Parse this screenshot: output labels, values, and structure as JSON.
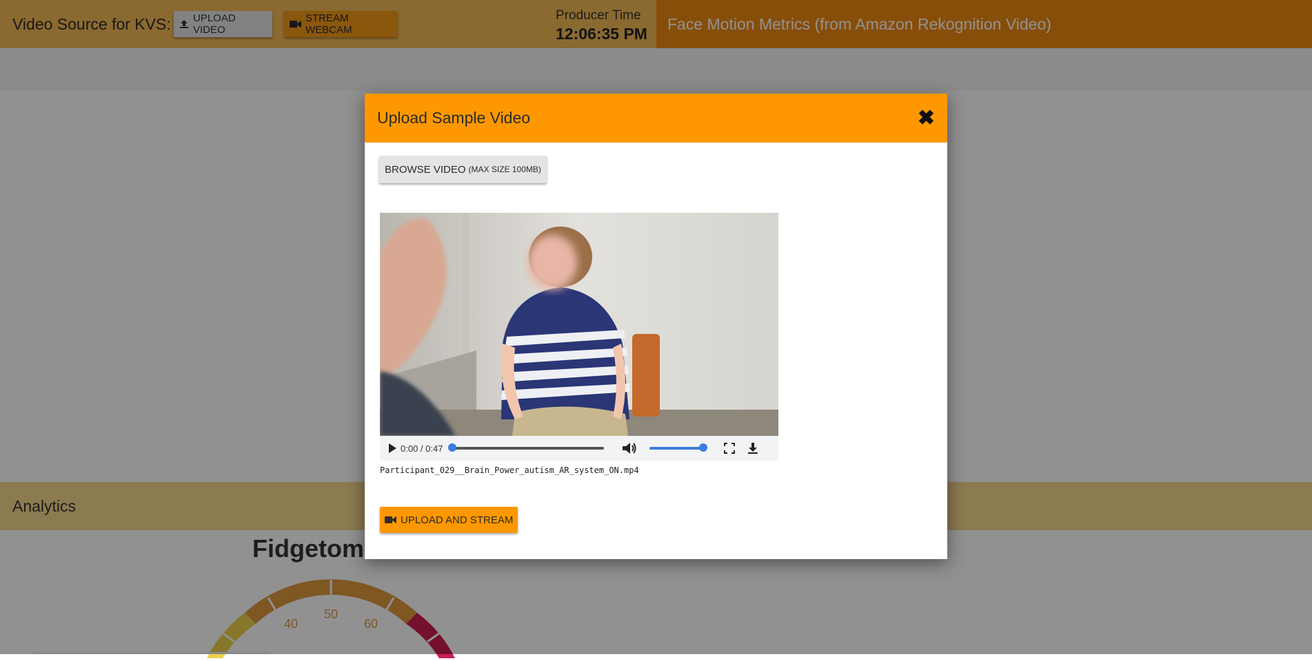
{
  "topbar": {
    "source_label": "Video Source for KVS:",
    "upload_video_label": "UPLOAD VIDEO",
    "stream_webcam_label": "STREAM WEBCAM",
    "producer_time_label": "Producer Time",
    "producer_time_value": "12:06:35 PM",
    "metrics_title": "Face Motion Metrics (from Amazon Rekognition Video)"
  },
  "analytics": {
    "label": "Analytics",
    "fidgetometer_title": "Fidgetometer",
    "gauge_ticks": [
      "40",
      "50",
      "60"
    ]
  },
  "modal": {
    "title": "Upload Sample Video",
    "browse_label": "BROWSE VIDEO",
    "browse_hint": "(MAX SIZE 100MB)",
    "player": {
      "time": "0:00 / 0:47",
      "progress": 0.0,
      "volume": 1.0
    },
    "filename": "Participant_029__Brain_Power_autism_AR_system_ON.mp4",
    "upload_stream_label": "UPLOAD AND STREAM"
  },
  "colors": {
    "topbar_left": "#f3ba55",
    "topbar_right": "#ee8a13",
    "modal_header": "#ff9800",
    "analytics_bar": "#f6d78e",
    "accent_blue": "#3b7ddd"
  },
  "icons": {
    "upload": "upload-icon",
    "camera": "video-camera-icon",
    "close": "close-icon",
    "play": "play-icon",
    "volume": "volume-icon",
    "fullscreen": "fullscreen-icon",
    "download": "download-icon"
  }
}
